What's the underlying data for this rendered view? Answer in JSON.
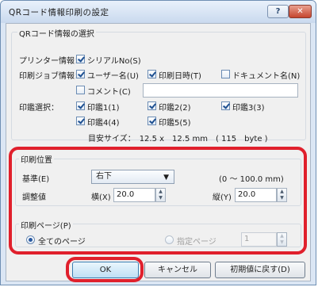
{
  "window": {
    "title": "QRコード情報印刷の設定",
    "help_label": "?",
    "close_label": "✕",
    "close_color": "#c5452e",
    "highlight_color": "#e0202c"
  },
  "qr_select": {
    "group_label": "QRコード情報の選択",
    "printer_info_label": "プリンター情報：",
    "printer_serial": {
      "label": "シリアルNo(S)",
      "checked": true
    },
    "job_info_label": "印刷ジョブ情報：",
    "username": {
      "label": "ユーザー名(U)",
      "checked": true
    },
    "print_datetime": {
      "label": "印刷日時(T)",
      "checked": true
    },
    "document_name": {
      "label": "ドキュメント名(N)",
      "checked": false
    },
    "comment": {
      "label": "コメント(C)",
      "checked": false,
      "value": ""
    },
    "stamp_select_label": "印鑑選択：",
    "stamps": [
      {
        "label": "印鑑1(1)",
        "checked": true
      },
      {
        "label": "印鑑2(2)",
        "checked": true
      },
      {
        "label": "印鑑3(3)",
        "checked": true
      },
      {
        "label": "印鑑4(4)",
        "checked": true
      },
      {
        "label": "印鑑5(5)",
        "checked": true
      }
    ],
    "size_text": "目安サイズ：　12.5 x　12.5 mm　( 115　byte )"
  },
  "print_position": {
    "group_label": "印刷位置",
    "base_label": "基準(E)",
    "base_value": "右下",
    "range_text": "(0 〜 100.0 mm)",
    "adjust_label": "調整値",
    "horizontal_label": "横(X)",
    "horizontal_value": "20.0",
    "vertical_label": "縦(Y)",
    "vertical_value": "20.0"
  },
  "print_page": {
    "group_label": "印刷ページ(P)",
    "all_pages_label": "全てのページ",
    "specified_pages_label": "指定ページ",
    "specified_value": "1",
    "selected": "all"
  },
  "buttons": {
    "ok": "OK",
    "cancel": "キャンセル",
    "reset": "初期値に戻す(D)"
  },
  "icons": {
    "dropdown": "chevron-down-icon",
    "spin_up": "▲",
    "spin_down": "▼",
    "dropdown_glyph": "▼"
  }
}
